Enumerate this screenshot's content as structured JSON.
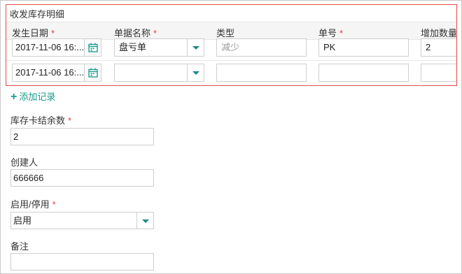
{
  "section": {
    "title": "收发库存明细"
  },
  "columns": [
    {
      "label": "发生日期",
      "required": "*"
    },
    {
      "label": "单据名称",
      "required": "*"
    },
    {
      "label": "类型",
      "required": ""
    },
    {
      "label": "单号",
      "required": "*"
    },
    {
      "label": "增加数量",
      "required": ""
    }
  ],
  "rows": [
    {
      "date": "2017-11-06 16:...",
      "doc_name": "盘亏单",
      "type_value": "",
      "type_placeholder": "减少",
      "number": "PK",
      "qty": "2"
    },
    {
      "date": "2017-11-06 16:...",
      "doc_name": "",
      "type_value": "",
      "type_placeholder": "",
      "number": "",
      "qty": ""
    }
  ],
  "add_record": {
    "icon": "plus-icon",
    "label": "添加记录"
  },
  "stock_balance": {
    "label": "库存卡结余数",
    "required": "*",
    "value": "2"
  },
  "creator": {
    "label": "创建人",
    "value": "666666"
  },
  "status": {
    "label": "启用/停用",
    "required": "*",
    "value": "启用"
  },
  "remark": {
    "label": "备注",
    "value": ""
  },
  "colors": {
    "accent": "#1a9a8a",
    "required": "#e04040",
    "highlight_border": "#e34a4a"
  }
}
